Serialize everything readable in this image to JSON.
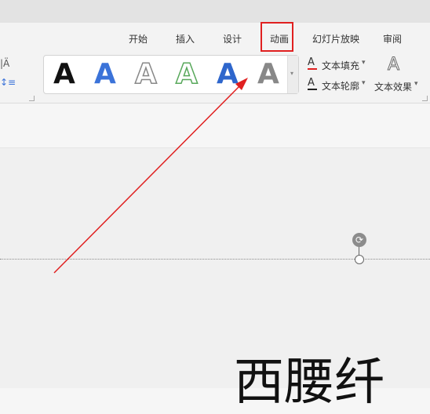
{
  "tabs": [
    {
      "label": "开始"
    },
    {
      "label": "插入"
    },
    {
      "label": "设计"
    },
    {
      "label": "动画"
    },
    {
      "label": "幻灯片放映"
    },
    {
      "label": "审阅"
    }
  ],
  "gallery": {
    "glyph": "A"
  },
  "commands": {
    "text_fill": "文本填充",
    "text_outline": "文本轮廓",
    "text_effects": "文本效果",
    "dropdown": "▾"
  },
  "left_controls": {
    "line_spacing": "|Ä",
    "para_spacing": "↕≡"
  },
  "slide": {
    "text": "西腰纤"
  },
  "colors": {
    "highlight": "#e02020",
    "accent_blue": "#3b73d9",
    "accent_green": "#58a85b"
  },
  "icons": {
    "rotate": "⟳",
    "fill": "A",
    "outline": "A",
    "effects": "A"
  }
}
